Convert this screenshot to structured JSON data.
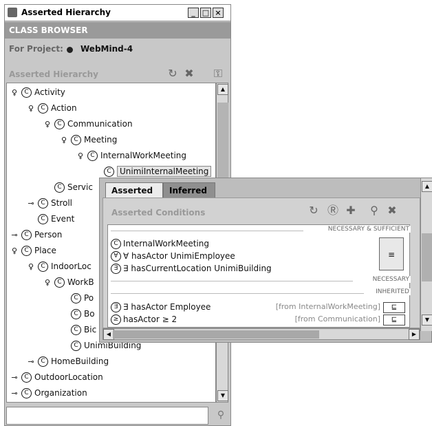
{
  "window": {
    "title": "Asserted Hierarchy",
    "controls": [
      "_",
      "□",
      "×"
    ]
  },
  "header": {
    "class_browser": "CLASS BROWSER",
    "project_label": "For Project:",
    "project_name": "WebMind-4"
  },
  "hierarchy": {
    "title": "Asserted Hierarchy",
    "icons": [
      "refresh-icon",
      "delete-icon",
      "key-icon"
    ]
  },
  "tree": [
    {
      "label": "Activity",
      "toggle": "open",
      "depth": 0
    },
    {
      "label": "Action",
      "toggle": "open",
      "depth": 1
    },
    {
      "label": "Communication",
      "toggle": "open",
      "depth": 2
    },
    {
      "label": "Meeting",
      "toggle": "open",
      "depth": 3
    },
    {
      "label": "InternalWorkMeeting",
      "toggle": "open",
      "depth": 4
    },
    {
      "label": "UnimiInternalMeeting",
      "toggle": "none",
      "depth": 5,
      "selected": true
    },
    {
      "label": "Servic",
      "toggle": "none",
      "depth": 2
    },
    {
      "label": "Stroll",
      "toggle": "closed",
      "depth": 1
    },
    {
      "label": "Event",
      "toggle": "none",
      "depth": 1
    },
    {
      "label": "Person",
      "toggle": "closed",
      "depth": 0
    },
    {
      "label": "Place",
      "toggle": "open",
      "depth": 0
    },
    {
      "label": "IndoorLoc",
      "toggle": "open",
      "depth": 1
    },
    {
      "label": "WorkB",
      "toggle": "open",
      "depth": 2
    },
    {
      "label": "Po",
      "toggle": "none",
      "depth": 3
    },
    {
      "label": "Bo",
      "toggle": "none",
      "depth": 3
    },
    {
      "label": "Bic",
      "toggle": "none",
      "depth": 3
    },
    {
      "label": "UnimiBuilding",
      "toggle": "none",
      "depth": 3
    },
    {
      "label": "HomeBuilding",
      "toggle": "closed",
      "depth": 1
    },
    {
      "label": "OutdoorLocation",
      "toggle": "closed",
      "depth": 0
    },
    {
      "label": "Organization",
      "toggle": "closed",
      "depth": 0
    }
  ],
  "dialog": {
    "tabs": [
      "Asserted",
      "Inferred"
    ],
    "conditions_title": "Asserted Conditions",
    "condition_icons": [
      "add-restriction-icon",
      "add-class-icon",
      "add-property-icon",
      "find-icon",
      "delete-icon"
    ],
    "sections": {
      "necessary_sufficient": "NECESSARY & SUFFICIENT",
      "necessary": "NECESSARY",
      "inherited": "INHERITED"
    },
    "equiv_symbol": "≡",
    "ns_conditions": [
      {
        "q": "C",
        "text": "InternalWorkMeeting"
      },
      {
        "q": "∀",
        "text": "∀ hasActor UnimiEmployee"
      },
      {
        "q": "∃",
        "text": "∃ hasCurrentLocation UnimiBuilding"
      }
    ],
    "inherited": [
      {
        "q": "∃",
        "text": "∃ hasActor Employee",
        "from": "[from InternalWorkMeeting]",
        "sym": "⊑"
      },
      {
        "q": "≥",
        "text": "hasActor ≥ 2",
        "from": "[from Communication]",
        "sym": "⊑"
      }
    ]
  }
}
